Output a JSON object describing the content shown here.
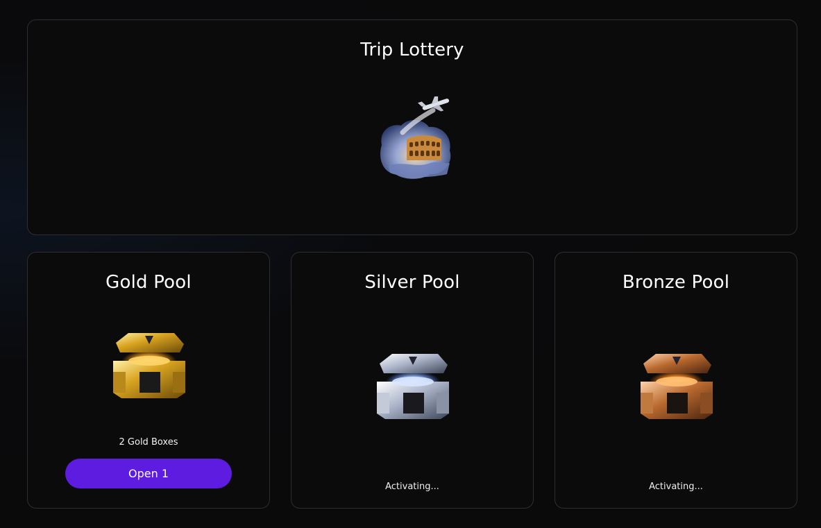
{
  "trip": {
    "title": "Trip Lottery",
    "image_icon": "airplane-colosseum-image"
  },
  "pools": {
    "gold": {
      "title": "Gold Pool",
      "image_icon": "gold-chest-image",
      "count_label": "2 Gold Boxes",
      "button_label": "Open 1",
      "accent": "#5d1ce0"
    },
    "silver": {
      "title": "Silver Pool",
      "image_icon": "silver-chest-image",
      "status": "Activating..."
    },
    "bronze": {
      "title": "Bronze Pool",
      "image_icon": "bronze-chest-image",
      "status": "Activating..."
    }
  }
}
